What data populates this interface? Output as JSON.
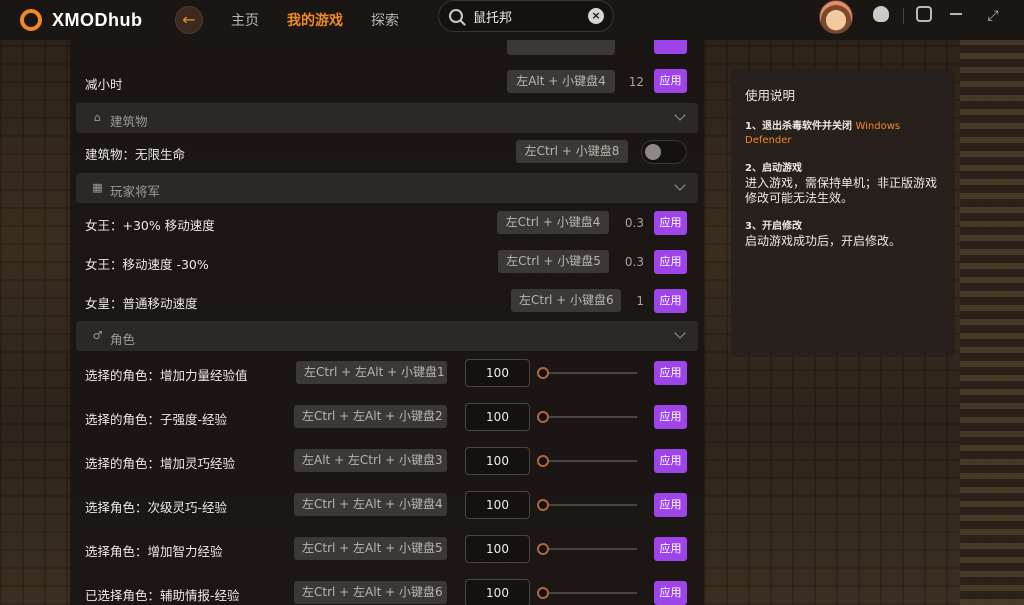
{
  "app": {
    "name": "XMODhub"
  },
  "nav": {
    "home": "主页",
    "my_games": "我的游戏",
    "explore": "探索"
  },
  "search": {
    "value": "鼠托邦"
  },
  "rows": {
    "r0": {
      "label": "减小时",
      "hotkey": "左Alt + 小键盘4",
      "value": "12",
      "apply": "应用"
    },
    "s_building": {
      "label": "建筑物",
      "icon": "building-icon"
    },
    "r1": {
      "label": "建筑物：无限生命",
      "hotkey": "左Ctrl + 小键盘8",
      "toggle": false
    },
    "s_player": {
      "label": "玩家将军",
      "icon": "grid-icon"
    },
    "r2": {
      "label": "女王：+30% 移动速度",
      "hotkey": "左Ctrl + 小键盘4",
      "value": "0.3",
      "apply": "应用"
    },
    "r3": {
      "label": "女王：移动速度 -30%",
      "hotkey": "左Ctrl + 小键盘5",
      "value": "0.3",
      "apply": "应用"
    },
    "r4": {
      "label": "女皇：普通移动速度",
      "hotkey": "左Ctrl + 小键盘6",
      "value": "1",
      "apply": "应用"
    },
    "s_role": {
      "label": "角色",
      "icon": "person-icon"
    },
    "r5": {
      "label": "选择的角色：增加力量经验值",
      "hotkey": "左Ctrl + 左Alt + 小键盘1",
      "input": "100",
      "slider": 0,
      "apply": "应用"
    },
    "r6": {
      "label": "选择的角色：子强度-经验",
      "hotkey": "左Ctrl + 左Alt + 小键盘2",
      "input": "100",
      "slider": 0,
      "apply": "应用"
    },
    "r7": {
      "label": "选择的角色：增加灵巧经验",
      "hotkey": "左Alt + 左Ctrl + 小键盘3",
      "input": "100",
      "slider": 0,
      "apply": "应用"
    },
    "r8": {
      "label": "选择角色：次级灵巧-经验",
      "hotkey": "左Ctrl + 左Alt + 小键盘4",
      "input": "100",
      "slider": 0,
      "apply": "应用"
    },
    "r9": {
      "label": "选择角色：增加智力经验",
      "hotkey": "左Ctrl + 左Alt + 小键盘5",
      "input": "100",
      "slider": 0,
      "apply": "应用"
    },
    "r10": {
      "label": "已选择角色：辅助情报-经验",
      "hotkey": "左Ctrl + 左Alt + 小键盘6",
      "input": "100",
      "slider": 0,
      "apply": "应用"
    }
  },
  "info": {
    "title": "使用说明",
    "step1_head": "1、退出杀毒软件并关闭",
    "step1_highlight": "Windows Defender",
    "step2_head": "2、启动游戏",
    "step2_body": "进入游戏，需保持单机；非正版游戏修改可能无法生效。",
    "step3_head": "3、开启修改",
    "step3_body": "启动游戏成功后，开启修改。"
  },
  "colors": {
    "accent": "#f08a24",
    "apply": "#9d45e8"
  }
}
